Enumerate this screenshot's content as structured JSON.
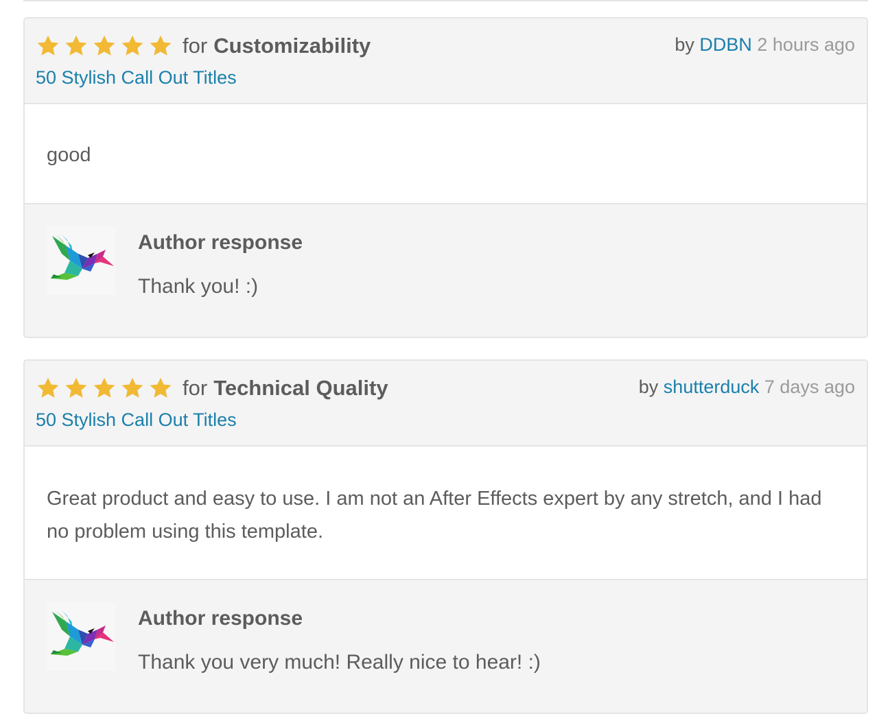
{
  "colors": {
    "star": "#f1b934",
    "link": "#1a7fab",
    "header_bg": "#f4f4f4",
    "text": "#5c5c5c",
    "muted": "#9a9a9a"
  },
  "reviews": [
    {
      "rating": 5,
      "for_word": "for",
      "category": "Customizability",
      "item": "50 Stylish Call Out Titles",
      "by_word": "by",
      "username": "DDBN",
      "time": "2 hours ago",
      "body": "good",
      "response": {
        "title": "Author response",
        "avatar_icon": "hummingbird-logo-icon",
        "text": "Thank you! :)"
      }
    },
    {
      "rating": 5,
      "for_word": "for",
      "category": "Technical Quality",
      "item": "50 Stylish Call Out Titles",
      "by_word": "by",
      "username": "shutterduck",
      "time": "7 days ago",
      "body": "Great product and easy to use. I am not an After Effects expert by any stretch, and I had no problem using this template.",
      "response": {
        "title": "Author response",
        "avatar_icon": "hummingbird-logo-icon",
        "text": "Thank you very much! Really nice to hear! :)"
      }
    }
  ]
}
